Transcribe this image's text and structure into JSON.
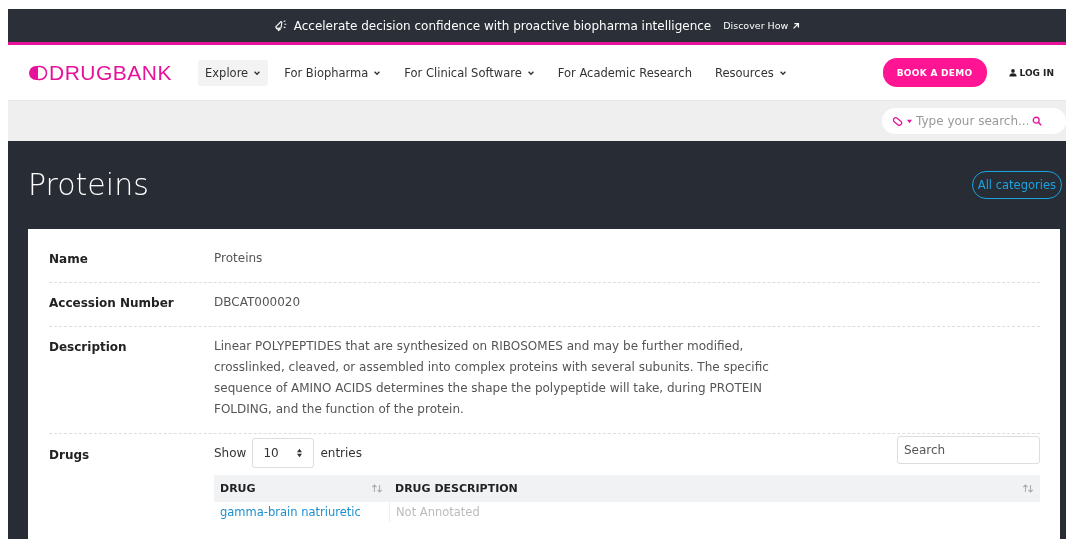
{
  "announcement": {
    "text": "Accelerate decision confidence with proactive biopharma intelligence",
    "link": "Discover How"
  },
  "nav": {
    "logo": "DRUGBANK",
    "items": [
      {
        "label": "Explore",
        "dropdown": true,
        "selected": true
      },
      {
        "label": "For Biopharma",
        "dropdown": true,
        "selected": false
      },
      {
        "label": "For Clinical Software",
        "dropdown": true,
        "selected": false
      },
      {
        "label": "For Academic Research",
        "dropdown": false,
        "selected": false
      },
      {
        "label": "Resources",
        "dropdown": true,
        "selected": false
      }
    ],
    "demo_button": "BOOK A DEMO",
    "login": "LOG IN"
  },
  "search": {
    "placeholder": "Type your search..."
  },
  "page": {
    "title": "Proteins",
    "all_categories": "All categories"
  },
  "fields": [
    {
      "kind": "text",
      "label": "Name",
      "value": "Proteins"
    },
    {
      "kind": "text",
      "label": "Accession Number",
      "value": "DBCAT000020"
    },
    {
      "kind": "text",
      "label": "Description",
      "value": "Linear POLYPEPTIDES that are synthesized on RIBOSOMES and may be further modified, crosslinked, cleaved, or assembled into complex proteins with several subunits. The specific sequence of AMINO ACIDS determines the shape the polypeptide will take, during PROTEIN FOLDING, and the function of the protein."
    },
    {
      "kind": "table",
      "label": "Drugs",
      "show_label": "Show",
      "page_size": "10",
      "entries_label": "entries",
      "search_placeholder": "Search",
      "columns": [
        "DRUG",
        "DRUG DESCRIPTION"
      ],
      "rows": [
        {
          "drug": "gamma-brain natriuretic",
          "description": "Not Annotated"
        }
      ]
    }
  ]
}
